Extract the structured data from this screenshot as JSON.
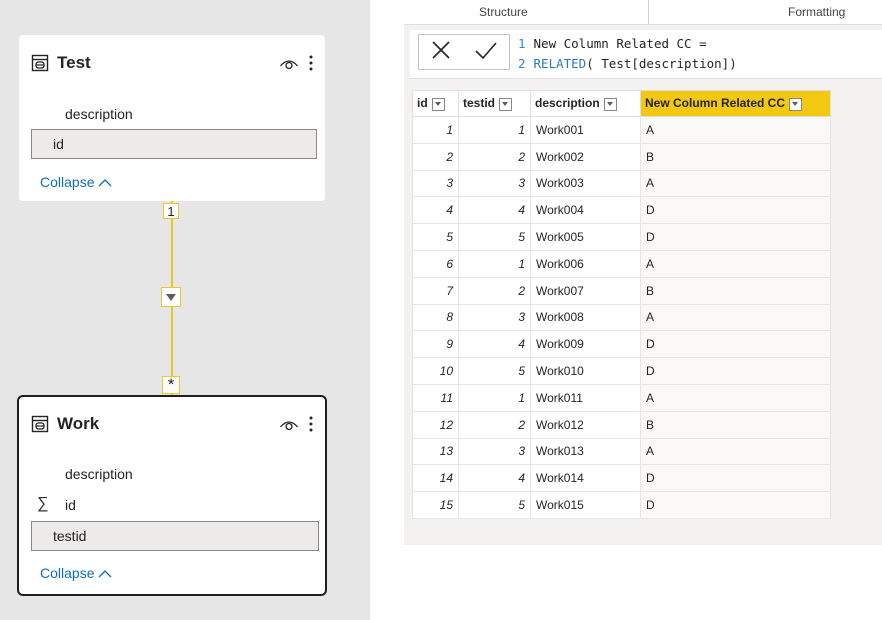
{
  "model": {
    "tables": [
      {
        "name": "Test",
        "fields": [
          {
            "label": "description",
            "selected": false,
            "aggregate": false
          },
          {
            "label": "id",
            "selected": true,
            "aggregate": false
          }
        ],
        "collapse_label": "Collapse"
      },
      {
        "name": "Work",
        "fields": [
          {
            "label": "description",
            "selected": false,
            "aggregate": false
          },
          {
            "label": "id",
            "selected": false,
            "aggregate": true
          },
          {
            "label": "testid",
            "selected": true,
            "aggregate": false
          }
        ],
        "collapse_label": "Collapse"
      }
    ],
    "relationship": {
      "one_side": "1",
      "many_side": "*"
    }
  },
  "ribbon": {
    "tabs": [
      "Structure",
      "Formatting"
    ]
  },
  "formula": {
    "line1_num": "1",
    "line1": "New Column Related CC =",
    "line2_num": "2",
    "line2_fn": "RELATED",
    "line2_args": "( Test[description])"
  },
  "table": {
    "columns": [
      "id",
      "testid",
      "description",
      "New Column Related CC"
    ],
    "rows": [
      [
        "1",
        "1",
        "Work001",
        "A"
      ],
      [
        "2",
        "2",
        "Work002",
        "B"
      ],
      [
        "3",
        "3",
        "Work003",
        "A"
      ],
      [
        "4",
        "4",
        "Work004",
        "D"
      ],
      [
        "5",
        "5",
        "Work005",
        "D"
      ],
      [
        "6",
        "1",
        "Work006",
        "A"
      ],
      [
        "7",
        "2",
        "Work007",
        "B"
      ],
      [
        "8",
        "3",
        "Work008",
        "A"
      ],
      [
        "9",
        "4",
        "Work009",
        "D"
      ],
      [
        "10",
        "5",
        "Work010",
        "D"
      ],
      [
        "11",
        "1",
        "Work011",
        "A"
      ],
      [
        "12",
        "2",
        "Work012",
        "B"
      ],
      [
        "13",
        "3",
        "Work013",
        "A"
      ],
      [
        "14",
        "4",
        "Work014",
        "D"
      ],
      [
        "15",
        "5",
        "Work015",
        "D"
      ]
    ]
  },
  "colors": {
    "accent": "#f2c811",
    "relationship_line": "#e8c82d",
    "link": "#0f6cbd",
    "canvas": "#e6e6e6"
  }
}
